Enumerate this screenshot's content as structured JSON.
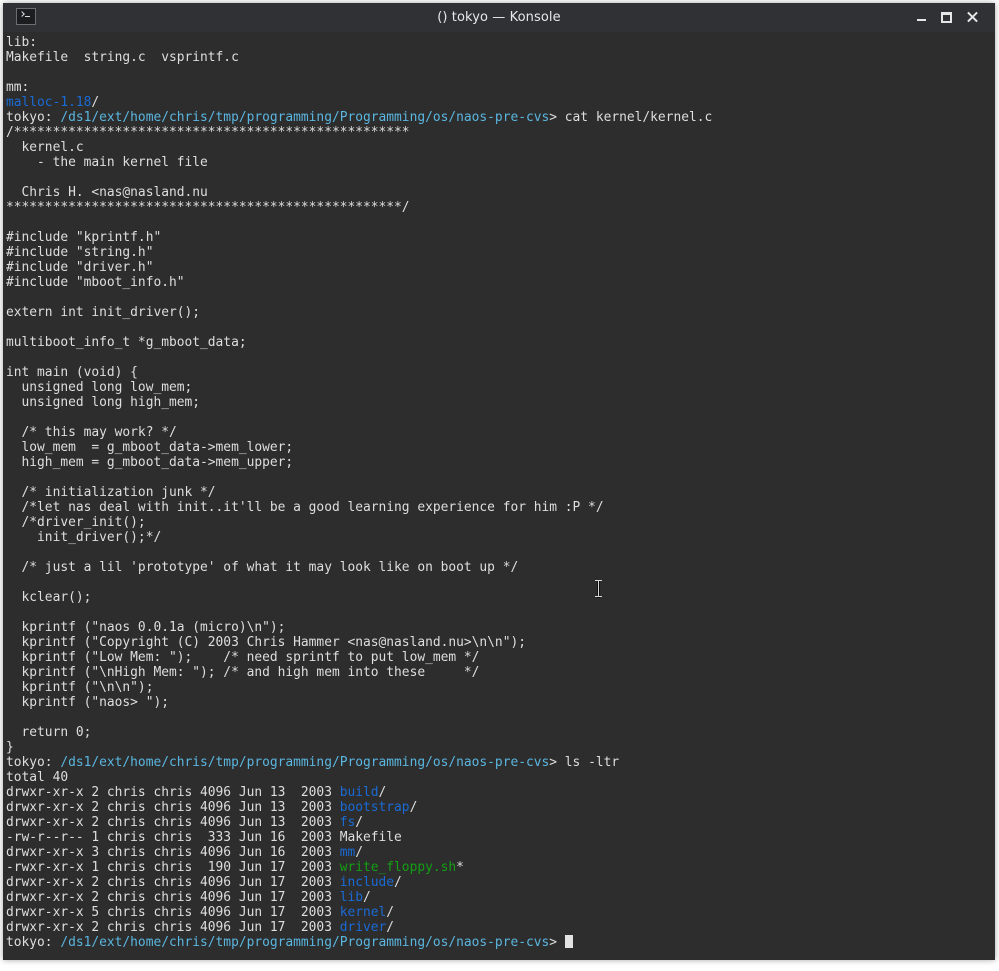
{
  "window": {
    "title": "() tokyo — Konsole",
    "icon": "terminal-icon",
    "buttons": [
      "minimize-icon",
      "maximize-icon",
      "close-icon"
    ]
  },
  "colors": {
    "background": "#2d2d2d",
    "text": "#dedede",
    "directory": "#1a6bd6",
    "prompt_path": "#5ab6e0",
    "executable": "#13a013"
  },
  "terminal": {
    "lines": [
      [
        {
          "t": "lib:"
        }
      ],
      [
        {
          "t": "Makefile  string.c  vsprintf.c"
        }
      ],
      [
        {
          "t": ""
        }
      ],
      [
        {
          "t": "mm:"
        }
      ],
      [
        {
          "t": "malloc-1.18",
          "c": "blue"
        },
        {
          "t": "/"
        }
      ],
      [
        {
          "t": "tokyo: "
        },
        {
          "t": "/ds1/ext/home/chris/tmp/programming/Programming/os/naos-pre-cvs",
          "c": "prompt-path"
        },
        {
          "t": "> cat kernel/kernel.c"
        }
      ],
      [
        {
          "t": "/***************************************************"
        }
      ],
      [
        {
          "t": "  kernel.c"
        }
      ],
      [
        {
          "t": "    - the main kernel file"
        }
      ],
      [
        {
          "t": ""
        }
      ],
      [
        {
          "t": "  Chris H. <nas@nasland.nu"
        }
      ],
      [
        {
          "t": "***************************************************/"
        }
      ],
      [
        {
          "t": ""
        }
      ],
      [
        {
          "t": "#include \"kprintf.h\""
        }
      ],
      [
        {
          "t": "#include \"string.h\""
        }
      ],
      [
        {
          "t": "#include \"driver.h\""
        }
      ],
      [
        {
          "t": "#include \"mboot_info.h\""
        }
      ],
      [
        {
          "t": ""
        }
      ],
      [
        {
          "t": "extern int init_driver();"
        }
      ],
      [
        {
          "t": ""
        }
      ],
      [
        {
          "t": "multiboot_info_t *g_mboot_data;"
        }
      ],
      [
        {
          "t": ""
        }
      ],
      [
        {
          "t": "int main (void) {"
        }
      ],
      [
        {
          "t": "  unsigned long low_mem;"
        }
      ],
      [
        {
          "t": "  unsigned long high_mem;"
        }
      ],
      [
        {
          "t": ""
        }
      ],
      [
        {
          "t": "  /* this may work? */"
        }
      ],
      [
        {
          "t": "  low_mem  = g_mboot_data->mem_lower;"
        }
      ],
      [
        {
          "t": "  high_mem = g_mboot_data->mem_upper;"
        }
      ],
      [
        {
          "t": ""
        }
      ],
      [
        {
          "t": "  /* initialization junk */"
        }
      ],
      [
        {
          "t": "  /*let nas deal with init..it'll be a good learning experience for him :P */"
        }
      ],
      [
        {
          "t": "  /*driver_init();"
        }
      ],
      [
        {
          "t": "    init_driver();*/"
        }
      ],
      [
        {
          "t": ""
        }
      ],
      [
        {
          "t": "  /* just a lil 'prototype' of what it may look like on boot up */"
        }
      ],
      [
        {
          "t": ""
        }
      ],
      [
        {
          "t": "  kclear();"
        }
      ],
      [
        {
          "t": ""
        }
      ],
      [
        {
          "t": "  kprintf (\"naos 0.0.1a (micro)\\n\");"
        }
      ],
      [
        {
          "t": "  kprintf (\"Copyright (C) 2003 Chris Hammer <nas@nasland.nu>\\n\\n\");"
        }
      ],
      [
        {
          "t": "  kprintf (\"Low Mem: \");    /* need sprintf to put low_mem */"
        }
      ],
      [
        {
          "t": "  kprintf (\"\\nHigh Mem: \"); /* and high mem into these     */"
        }
      ],
      [
        {
          "t": "  kprintf (\"\\n\\n\");"
        }
      ],
      [
        {
          "t": "  kprintf (\"naos> \");"
        }
      ],
      [
        {
          "t": ""
        }
      ],
      [
        {
          "t": "  return 0;"
        }
      ],
      [
        {
          "t": "}"
        }
      ],
      [
        {
          "t": "tokyo: "
        },
        {
          "t": "/ds1/ext/home/chris/tmp/programming/Programming/os/naos-pre-cvs",
          "c": "prompt-path"
        },
        {
          "t": "> ls -ltr"
        }
      ],
      [
        {
          "t": "total 40"
        }
      ],
      [
        {
          "t": "drwxr-xr-x 2 chris chris 4096 Jun 13  2003 "
        },
        {
          "t": "build",
          "c": "blue"
        },
        {
          "t": "/"
        }
      ],
      [
        {
          "t": "drwxr-xr-x 2 chris chris 4096 Jun 13  2003 "
        },
        {
          "t": "bootstrap",
          "c": "blue"
        },
        {
          "t": "/"
        }
      ],
      [
        {
          "t": "drwxr-xr-x 2 chris chris 4096 Jun 13  2003 "
        },
        {
          "t": "fs",
          "c": "blue"
        },
        {
          "t": "/"
        }
      ],
      [
        {
          "t": "-rw-r--r-- 1 chris chris  333 Jun 16  2003 Makefile"
        }
      ],
      [
        {
          "t": "drwxr-xr-x 3 chris chris 4096 Jun 16  2003 "
        },
        {
          "t": "mm",
          "c": "blue"
        },
        {
          "t": "/"
        }
      ],
      [
        {
          "t": "-rwxr-xr-x 1 chris chris  190 Jun 17  2003 "
        },
        {
          "t": "write_floppy.sh",
          "c": "exec"
        },
        {
          "t": "*"
        }
      ],
      [
        {
          "t": "drwxr-xr-x 2 chris chris 4096 Jun 17  2003 "
        },
        {
          "t": "include",
          "c": "blue"
        },
        {
          "t": "/"
        }
      ],
      [
        {
          "t": "drwxr-xr-x 2 chris chris 4096 Jun 17  2003 "
        },
        {
          "t": "lib",
          "c": "blue"
        },
        {
          "t": "/"
        }
      ],
      [
        {
          "t": "drwxr-xr-x 5 chris chris 4096 Jun 17  2003 "
        },
        {
          "t": "kernel",
          "c": "blue"
        },
        {
          "t": "/"
        }
      ],
      [
        {
          "t": "drwxr-xr-x 2 chris chris 4096 Jun 17  2003 "
        },
        {
          "t": "driver",
          "c": "blue"
        },
        {
          "t": "/"
        }
      ],
      [
        {
          "t": "tokyo: "
        },
        {
          "t": "/ds1/ext/home/chris/tmp/programming/Programming/os/naos-pre-cvs",
          "c": "prompt-path"
        },
        {
          "t": "> "
        },
        {
          "cursor": true
        }
      ]
    ]
  }
}
